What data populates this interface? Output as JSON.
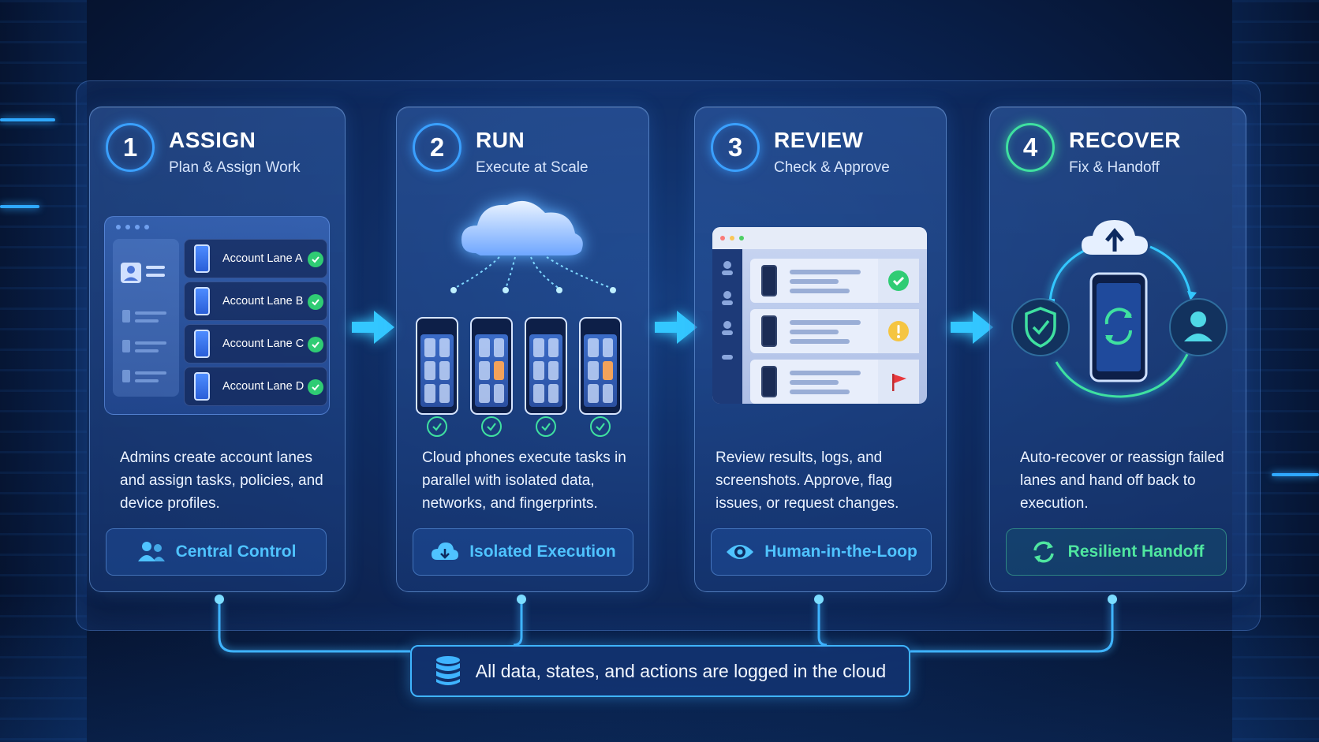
{
  "steps": [
    {
      "number": "1",
      "title": "ASSIGN",
      "subtitle": "Plan & Assign Work",
      "description": "Admins create account lanes and assign tasks, policies, and device profiles.",
      "badge": "Central Control"
    },
    {
      "number": "2",
      "title": "RUN",
      "subtitle": "Execute at Scale",
      "description": "Cloud phones execute tasks in parallel with isolated data, networks, and fingerprints.",
      "badge": "Isolated Execution"
    },
    {
      "number": "3",
      "title": "REVIEW",
      "subtitle": "Check & Approve",
      "description": "Review results, logs, and screenshots. Approve, flag issues, or request changes.",
      "badge": "Human-in-the-Loop"
    },
    {
      "number": "4",
      "title": "RECOVER",
      "subtitle": "Fix & Handoff",
      "description": "Auto-recover or reassign failed lanes and hand off back to execution.",
      "badge": "Resilient Handoff"
    }
  ],
  "lanes": [
    "Account Lane A",
    "Account Lane B",
    "Account Lane C",
    "Account Lane D"
  ],
  "review_statuses": [
    "approved-icon",
    "warning-icon",
    "flag-icon"
  ],
  "footer": {
    "text": "All data, states, and actions are logged in the cloud"
  },
  "colors": {
    "accent_blue": "#3aa0ff",
    "accent_cyan": "#4fc3ff",
    "accent_green": "#3fe0a0",
    "check_green": "#2fcc74",
    "warning_yellow": "#f5c542",
    "flag_red": "#e8383d"
  }
}
